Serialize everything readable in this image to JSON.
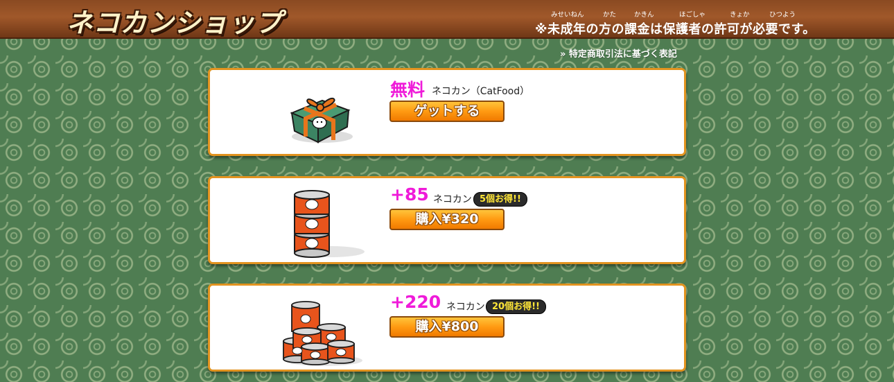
{
  "header": {
    "logo": "ネコカンショップ",
    "notice": "※未成年の方の課金は保護者の許可が必要です。",
    "ruby": {
      "misei": "みせいねん",
      "kata": "かた",
      "kakin": "かきん",
      "hogosha": "ほごしゃ",
      "kyoka": "きょか",
      "hitsuyou": "ひつよう"
    }
  },
  "law_link": "» 特定商取引法に基づく表記",
  "items": [
    {
      "amount": "無料",
      "unit": "ネコカン（CatFood）",
      "button": "ゲットする",
      "art": "gift-box"
    },
    {
      "amount": "+85",
      "unit": "ネコカン",
      "bonus": "5個お得!!",
      "button": "購入¥320",
      "art": "can-stack"
    },
    {
      "amount": "+220",
      "unit": "ネコカン",
      "bonus": "20個お得!!",
      "button": "購入¥800",
      "art": "can-pile"
    }
  ],
  "colors": {
    "accent_magenta": "#ef1bd9",
    "button_orange": "#ff9a12",
    "card_border": "#e2931f",
    "header_brown": "#8a4a22",
    "background_green": "#4f7d52"
  }
}
